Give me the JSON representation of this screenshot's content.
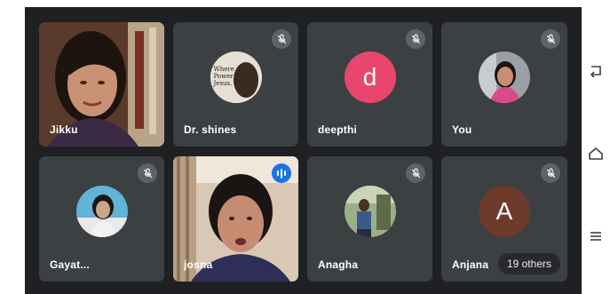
{
  "participants": [
    {
      "name": "Jikku",
      "muted": false,
      "type": "video"
    },
    {
      "name": "Dr. shines",
      "muted": true,
      "type": "photo"
    },
    {
      "name": "deepthi",
      "muted": true,
      "type": "letter",
      "letter": "d",
      "color": "#e8466d"
    },
    {
      "name": "You",
      "muted": true,
      "type": "photo"
    },
    {
      "name": "Gayat...",
      "muted": true,
      "type": "photo"
    },
    {
      "name": "josna",
      "muted": false,
      "speaking": true,
      "type": "video"
    },
    {
      "name": "Anagha",
      "muted": true,
      "type": "photo"
    },
    {
      "name": "Anjana",
      "muted": true,
      "type": "letter",
      "letter": "A",
      "color": "#6d3a2c"
    }
  ],
  "avatar_text": {
    "dr_shines": "Where Power Jesus."
  },
  "others_label": "19 others",
  "icons": {
    "mute": "mic-off-icon",
    "speaking": "audio-level-icon",
    "back": "back-icon",
    "home": "home-icon",
    "menu": "menu-icon"
  },
  "colors": {
    "background": "#1f2023",
    "tile": "#3c4043",
    "speaking": "#1a73e8"
  }
}
